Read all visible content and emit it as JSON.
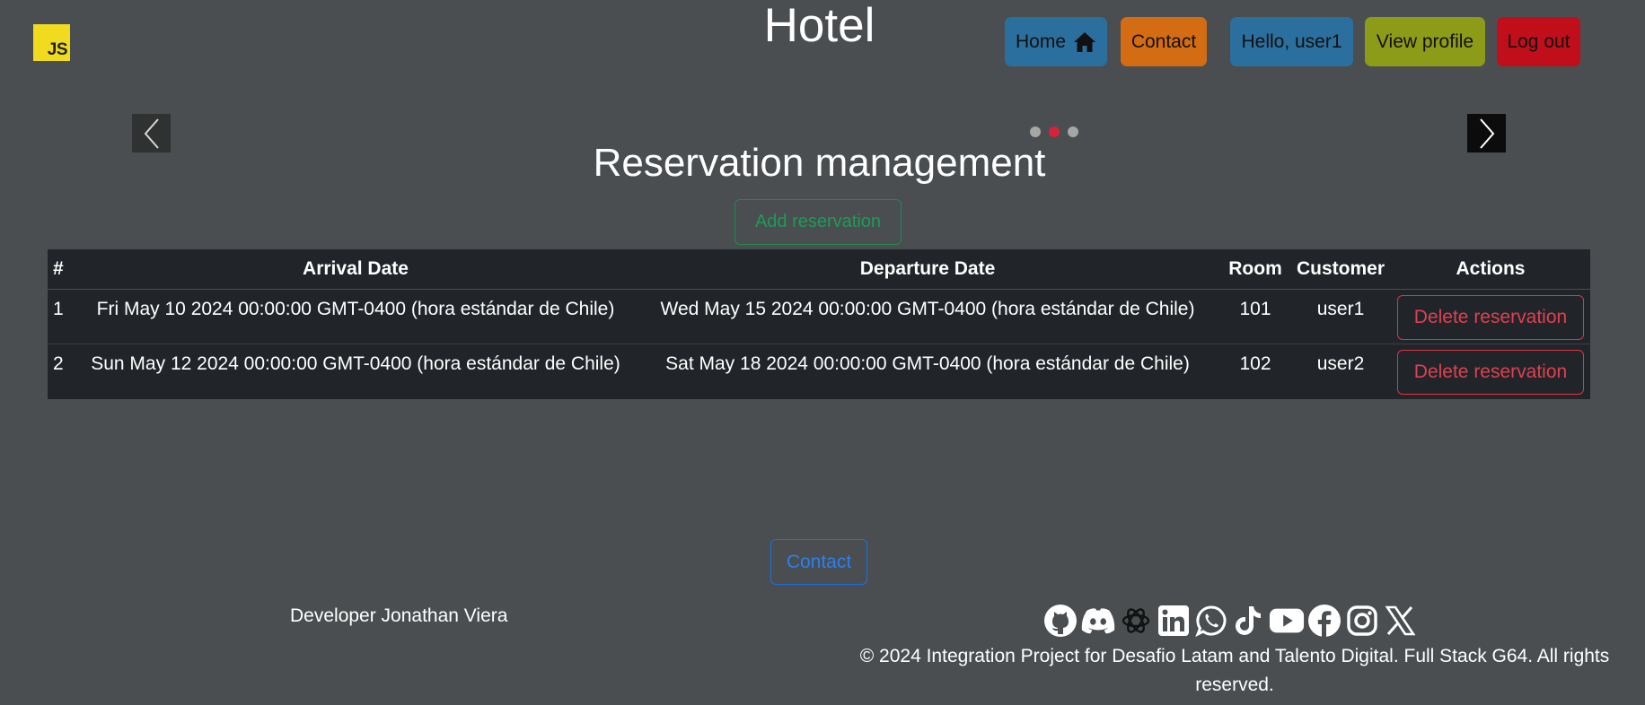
{
  "header": {
    "logo_text": "JS",
    "title": "Hotel",
    "nav": {
      "home": "Home",
      "contact": "Contact",
      "greeting": "Hello, user1",
      "profile": "View profile",
      "logout": "Log out"
    },
    "colors": {
      "home": "#2b6f9e",
      "contact": "#d36c12",
      "greeting": "#2b6f9e",
      "profile": "#8c9c18",
      "logout": "#c00f1a"
    }
  },
  "carousel": {
    "slides": 3,
    "active_slide": 2
  },
  "main": {
    "title": "Reservation management",
    "add_button": "Add reservation",
    "table": {
      "columns": [
        "#",
        "Arrival Date",
        "Departure Date",
        "Room",
        "Customer",
        "Actions"
      ],
      "rows": [
        {
          "id": "1",
          "arrival": "Fri May 10 2024 00:00:00 GMT-0400 (hora estándar de Chile)",
          "departure": "Wed May 15 2024 00:00:00 GMT-0400 (hora estándar de Chile)",
          "room": "101",
          "customer": "user1",
          "action": "Delete reservation"
        },
        {
          "id": "2",
          "arrival": "Sun May 12 2024 00:00:00 GMT-0400 (hora estándar de Chile)",
          "departure": "Sat May 18 2024 00:00:00 GMT-0400 (hora estándar de Chile)",
          "room": "102",
          "customer": "user2",
          "action": "Delete reservation"
        }
      ]
    }
  },
  "footer": {
    "contact_button": "Contact",
    "developer": "Developer Jonathan Viera",
    "social_icons": [
      "github-icon",
      "discord-icon",
      "openai-icon",
      "linkedin-icon",
      "whatsapp-icon",
      "tiktok-icon",
      "youtube-icon",
      "facebook-icon",
      "instagram-icon",
      "x-icon"
    ],
    "copyright": "© 2024 Integration Project for Desafio Latam and Talento Digital. Full Stack G64. All rights reserved."
  }
}
